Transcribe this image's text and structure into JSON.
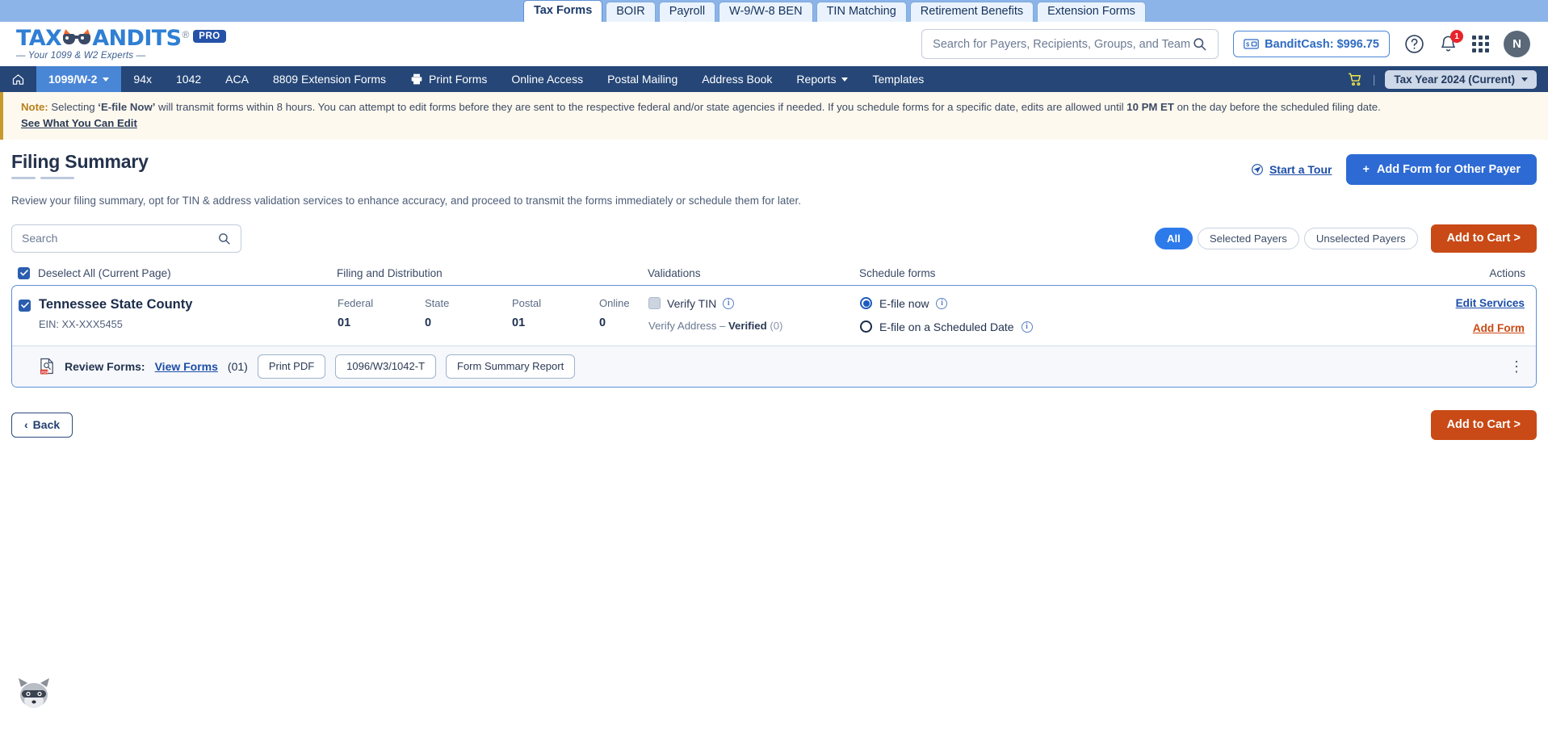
{
  "product_tabs": [
    {
      "label": "Tax Forms",
      "active": true
    },
    {
      "label": "BOIR",
      "active": false
    },
    {
      "label": "Payroll",
      "active": false
    },
    {
      "label": "W-9/W-8 BEN",
      "active": false
    },
    {
      "label": "TIN Matching",
      "active": false
    },
    {
      "label": "Retirement Benefits",
      "active": false
    },
    {
      "label": "Extension Forms",
      "active": false
    }
  ],
  "brand": {
    "name_part1": "TAX",
    "name_part2": "ANDITS",
    "registered": "®",
    "pro": "PRO",
    "tagline": "— Your 1099 & W2 Experts —"
  },
  "header": {
    "search_placeholder": "Search for Payers, Recipients, Groups, and Team Members",
    "search_value": "",
    "bandit_cash": "BanditCash: $996.75",
    "notification_count": "1",
    "avatar_initial": "N"
  },
  "nav": {
    "items": [
      {
        "label": "1099/W-2",
        "active": true,
        "caret": true
      },
      {
        "label": "94x",
        "active": false,
        "caret": false
      },
      {
        "label": "1042",
        "active": false,
        "caret": false
      },
      {
        "label": "ACA",
        "active": false,
        "caret": false
      },
      {
        "label": "8809 Extension Forms",
        "active": false,
        "caret": false
      },
      {
        "label": "Print Forms",
        "active": false,
        "caret": false,
        "icon": "printer-icon"
      },
      {
        "label": "Online Access",
        "active": false,
        "caret": false
      },
      {
        "label": "Postal Mailing",
        "active": false,
        "caret": false
      },
      {
        "label": "Address Book",
        "active": false,
        "caret": false
      },
      {
        "label": "Reports",
        "active": false,
        "caret": true
      },
      {
        "label": "Templates",
        "active": false,
        "caret": false
      }
    ],
    "tax_year": "Tax Year 2024 (Current)"
  },
  "note": {
    "label": "Note:",
    "text_1": " Selecting ",
    "bold_1": "‘E-file Now’",
    "text_2": " will transmit forms within 8 hours. You can attempt to edit forms before they are sent to the respective federal and/or state agencies if needed. If you schedule forms for a specific date, edits are allowed until ",
    "bold_2": "10 PM ET",
    "text_3": " on the day before the scheduled filing date.",
    "link": "See What You Can Edit"
  },
  "page": {
    "title": "Filing Summary",
    "subtitle": "Review your filing summary, opt for TIN & address validation services to enhance accuracy, and proceed to transmit the forms immediately or schedule them for later.",
    "start_tour": "Start a Tour",
    "add_form_other_payer": "+ Add Form for Other Payer",
    "add_form_other_payer_label": "Add Form for Other Payer",
    "plus": "+"
  },
  "toolbar": {
    "search_placeholder": "Search",
    "search_value": "",
    "filters": [
      {
        "label": "All",
        "active": true
      },
      {
        "label": "Selected Payers",
        "active": false
      },
      {
        "label": "Unselected Payers",
        "active": false
      }
    ],
    "add_to_cart": "Add to Cart >"
  },
  "table": {
    "headers": {
      "select_all": "Deselect All (Current Page)",
      "filing": "Filing and Distribution",
      "validations": "Validations",
      "schedule": "Schedule forms",
      "actions": "Actions"
    },
    "rows": [
      {
        "checked": true,
        "payer_name": "Tennessee State County",
        "ein": "EIN: XX-XXX5455",
        "filing": [
          {
            "label": "Federal",
            "value": "01"
          },
          {
            "label": "State",
            "value": "0"
          },
          {
            "label": "Postal",
            "value": "01"
          },
          {
            "label": "Online",
            "value": "0"
          }
        ],
        "verify_tin": "Verify TIN",
        "verify_tin_checked": false,
        "verify_address_label": "Verify Address",
        "verify_address_dash": "–",
        "verify_address_status": "Verified",
        "verify_address_count": "(0)",
        "schedule_options": [
          {
            "label": "E-file now",
            "selected": true
          },
          {
            "label": "E-file on a Scheduled Date",
            "selected": false
          }
        ],
        "edit_services": "Edit Services",
        "add_form": "Add Form",
        "review_label": "Review Forms:",
        "view_forms": "View Forms",
        "view_forms_count": "(01)",
        "buttons": [
          "Print PDF",
          "1096/W3/1042-T",
          "Form Summary Report"
        ]
      }
    ]
  },
  "bottom": {
    "back": "Back",
    "add_to_cart": "Add to Cart >"
  }
}
